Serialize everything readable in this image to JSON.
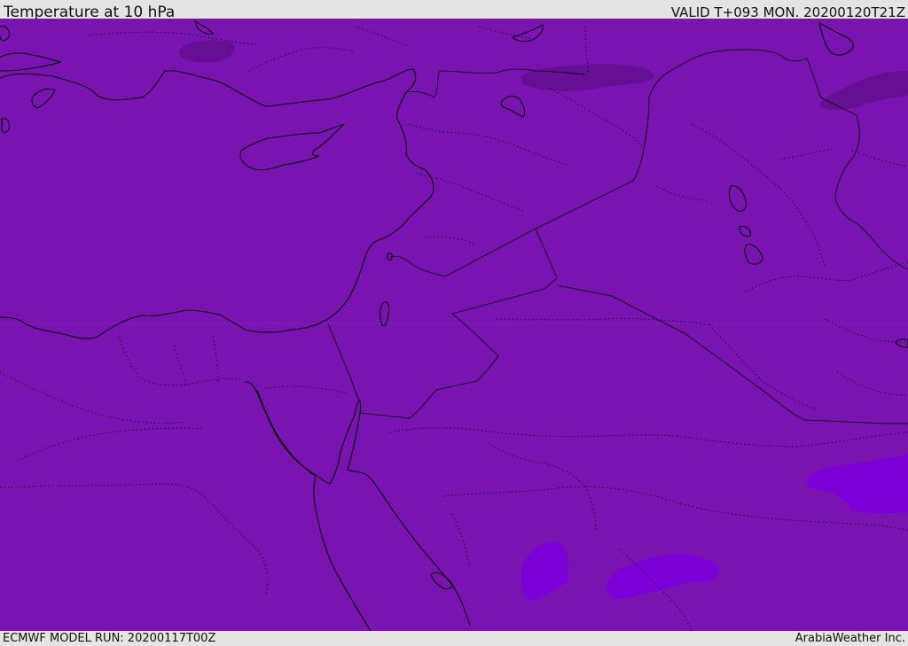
{
  "header": {
    "title": "Temperature at 10 hPa",
    "valid": "VALID T+093 MON. 20200120T21Z"
  },
  "footer": {
    "model_run": "ECMWF MODEL RUN: 20200117T00Z",
    "credit": "ArabiaWeather Inc."
  },
  "colors": {
    "field_base": "#7a14b0",
    "field_cold": "#660f94",
    "field_warm": "#7c00d8",
    "coastline": "#000000"
  }
}
